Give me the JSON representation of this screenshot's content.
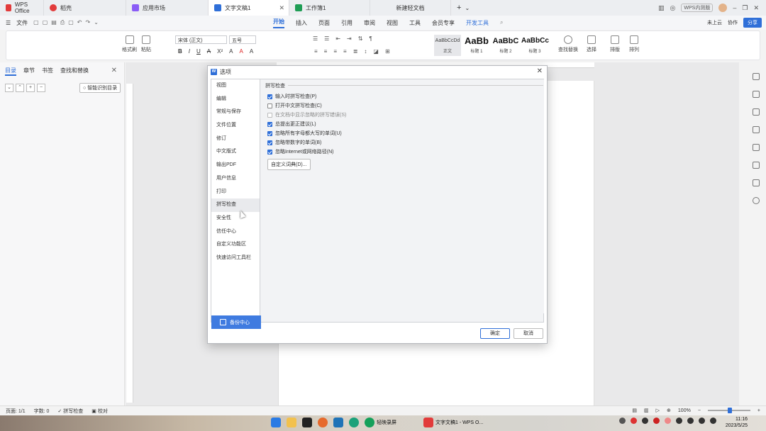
{
  "titlebar": {
    "tabs": [
      {
        "label": "WPS Office",
        "color": "#e23b3b"
      },
      {
        "label": "稻壳",
        "color": "#e23b3b"
      },
      {
        "label": "应用市场",
        "color": "#8a5cf6"
      },
      {
        "label": "文字文稿1",
        "color": "#2f6fd8"
      },
      {
        "label": "工作簿1",
        "color": "#1f9d55"
      },
      {
        "label": "新建轻文档",
        "color": ""
      }
    ],
    "badge": "WPS内测版"
  },
  "menubar": {
    "file": "文件",
    "tabs": [
      "开始",
      "插入",
      "页面",
      "引用",
      "审阅",
      "视图",
      "工具",
      "会员专享",
      "开发工具"
    ],
    "not_uploaded": "未上云",
    "collab": "协作",
    "share": "分享"
  },
  "ribbon": {
    "format_painter": "格式刷",
    "paste": "粘贴",
    "font": "宋体 (正文)",
    "size": "五号",
    "styles": [
      {
        "preview": "AaBbCcDd",
        "label": "正文"
      },
      {
        "preview": "AaBb",
        "label": "标题 1"
      },
      {
        "preview": "AaBbC",
        "label": "标题 2"
      },
      {
        "preview": "AaBbCc",
        "label": "标题 3"
      }
    ],
    "find_replace": "查找替换",
    "select": "选择",
    "layout": "排版",
    "arrange": "排列"
  },
  "navpane": {
    "tabs": [
      "目录",
      "章节",
      "书签",
      "查找和替换"
    ],
    "smart_toc": "智能识别目录"
  },
  "dialog": {
    "title": "选项",
    "categories": [
      "视图",
      "编辑",
      "常规与保存",
      "文件位置",
      "修订",
      "中文版式",
      "输出PDF",
      "用户信息",
      "打印",
      "拼写检查",
      "安全性",
      "信任中心",
      "自定义功能区",
      "快速访问工具栏"
    ],
    "selected_category": "拼写检查",
    "backup": "备份中心",
    "section_title": "拼写检查",
    "options": [
      {
        "label": "输入时拼写检查(P)",
        "checked": true,
        "disabled": false
      },
      {
        "label": "打开中文拼写检查(C)",
        "checked": false,
        "disabled": false
      },
      {
        "label": "在文档中显示忽略的拼写错误(S)",
        "checked": false,
        "disabled": true
      },
      {
        "label": "总提出更正建议(L)",
        "checked": true,
        "disabled": false
      },
      {
        "label": "忽略所有字母都大写的单词(U)",
        "checked": true,
        "disabled": false
      },
      {
        "label": "忽略带数字的单词(B)",
        "checked": true,
        "disabled": false
      },
      {
        "label": "忽略Internet或网络路径(N)",
        "checked": true,
        "disabled": false
      }
    ],
    "custom_dict": "自定义词典(D)...",
    "ok": "确定",
    "cancel": "取消"
  },
  "statusbar": {
    "page": "页面: 1/1",
    "words": "字数: 0",
    "spell": "拼写检查",
    "proof": "校对",
    "zoom": "100%"
  },
  "taskbar": {
    "apps": [
      "轻映录屏",
      "文字文稿1 - WPS O..."
    ],
    "time": "11:16",
    "date": "2023/5/25"
  }
}
